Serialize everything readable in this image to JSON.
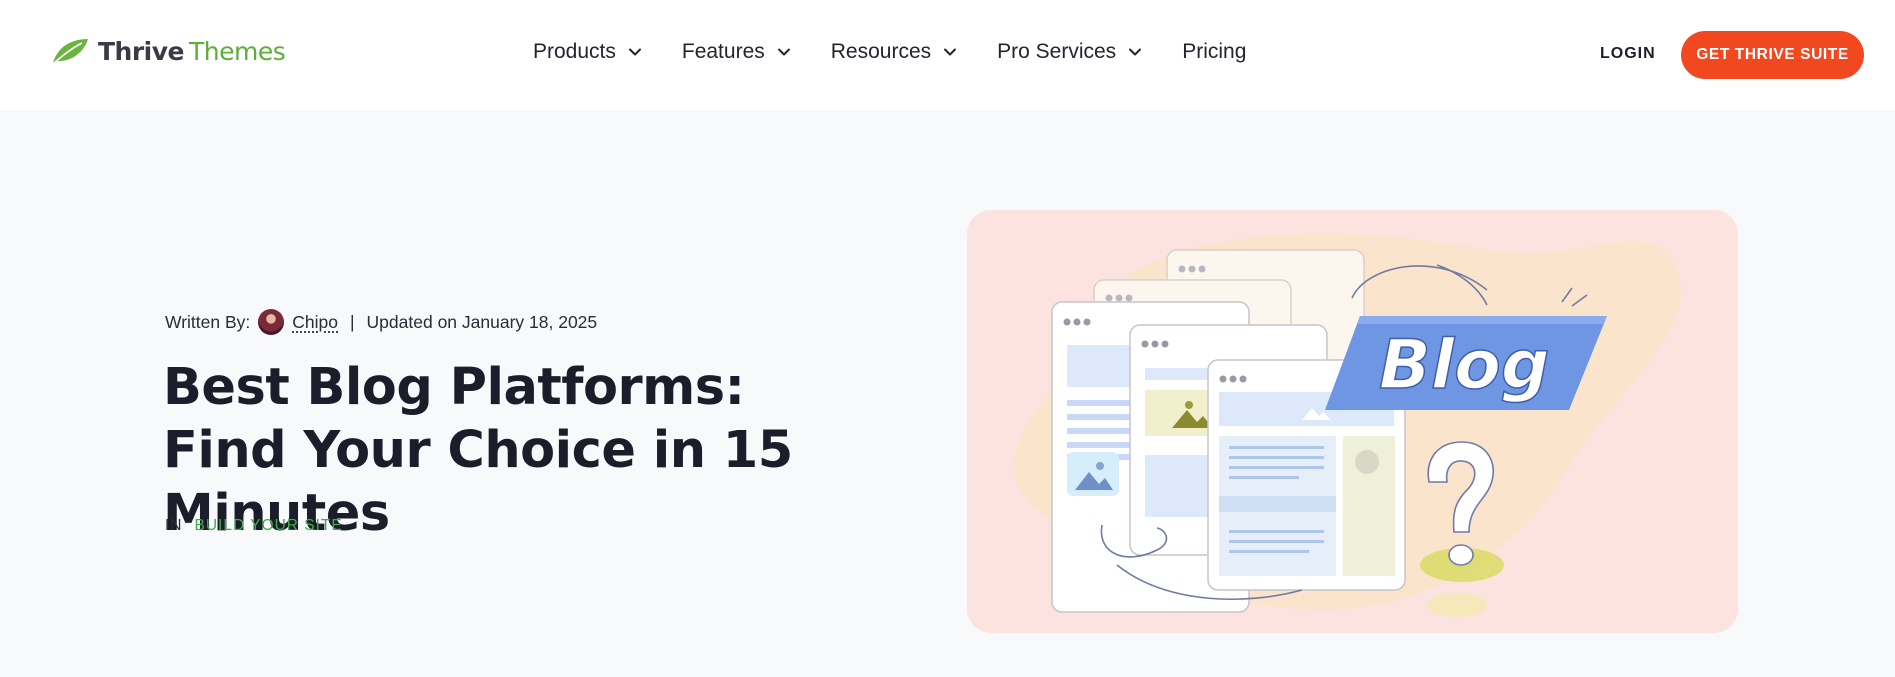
{
  "header": {
    "logo": {
      "thrive": "Thrive",
      "themes": "Themes",
      "leaf_icon": "leaf-icon"
    },
    "nav": [
      {
        "label": "Products",
        "has_dropdown": true
      },
      {
        "label": "Features",
        "has_dropdown": true
      },
      {
        "label": "Resources",
        "has_dropdown": true
      },
      {
        "label": "Pro Services",
        "has_dropdown": true
      },
      {
        "label": "Pricing",
        "has_dropdown": false
      }
    ],
    "login_label": "LOGIN",
    "cta_label": "GET THRIVE SUITE"
  },
  "article": {
    "written_by_label": "Written By:",
    "author": "Chipo",
    "separator": "|",
    "updated": "Updated on January 18, 2025",
    "title": "Best Blog Platforms: Find Your Choice in 15 Minutes",
    "category_prefix": "IN",
    "category": "BUILD YOUR SITE"
  },
  "hero_image": {
    "badge_text": "Blog",
    "icons": [
      "browser-window-icon",
      "image-icon",
      "question-mark-icon"
    ]
  },
  "colors": {
    "accent_green": "#5fae3a",
    "category_green": "#3fae4a",
    "cta_orange": "#f24820",
    "hero_bg": "#fde3df",
    "page_bg": "#f8f9fb",
    "text_dark": "#1c1d2b"
  }
}
